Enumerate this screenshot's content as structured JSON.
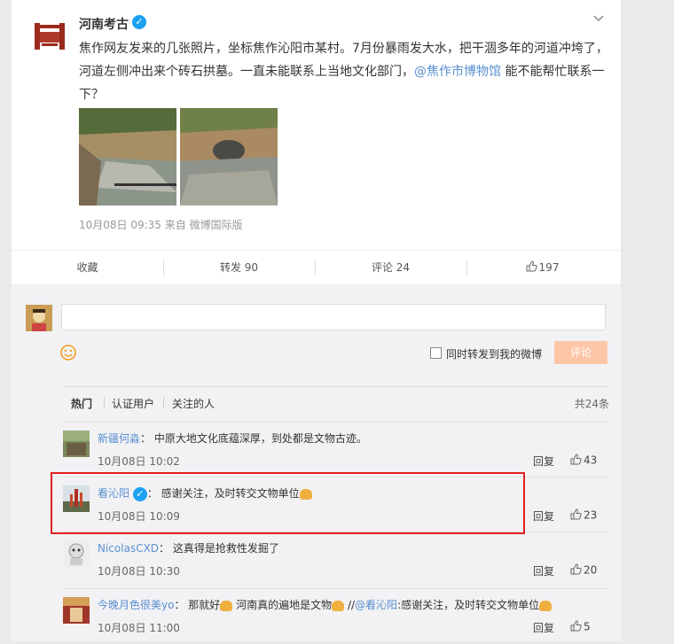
{
  "post": {
    "author": "河南考古",
    "text_before_mention": "焦作网友发来的几张照片，坐标焦作沁阳市某村。7月份暴雨发大水，把干涸多年的河道冲垮了，河道左侧冲出来个砖石拱墓。一直未能联系上当地文化部门，",
    "mention": "@焦作市博物馆",
    "text_after_mention": " 能不能帮忙联系一下？",
    "meta": "10月08日 09:35  来自 微博国际版"
  },
  "actions": {
    "favorite": "收藏",
    "repost": "转发 90",
    "comment": "评论 24",
    "like": "197"
  },
  "composer": {
    "repost_label": "同时转发到我的微博",
    "submit_label": "评论"
  },
  "filters": {
    "hot": "热门",
    "verified": "认证用户",
    "following": "关注的人",
    "total": "共24条"
  },
  "comments": [
    {
      "user": "新疆何淼",
      "text": "： 中原大地文化底蕴深厚，到处都是文物古迹。",
      "time": "10月08日 10:02",
      "reply": "回复",
      "likes": "43"
    },
    {
      "user": "看沁阳",
      "text": "： 感谢关注，及时转交文物单位",
      "time": "10月08日 10:09",
      "reply": "回复",
      "likes": "23"
    },
    {
      "user": "NicolasCXD",
      "text": "： 这真得是抢救性发掘了",
      "time": "10月08日 10:30",
      "reply": "回复",
      "likes": "20"
    },
    {
      "user": "今晚月色很美yo",
      "text": "： 那就好",
      "text2": "河南真的遍地是文物",
      "text3": "//",
      "mention": "@看沁阳",
      "text4": ":感谢关注，及时转交文物单位",
      "time": "10月08日 11:00",
      "reply": "回复",
      "likes": "5"
    }
  ],
  "colors": {
    "link": "#5a8fd0",
    "verified_badge": "#1da1f2",
    "highlight_box": "#e02020",
    "submit_button": "#fdc6a6"
  }
}
